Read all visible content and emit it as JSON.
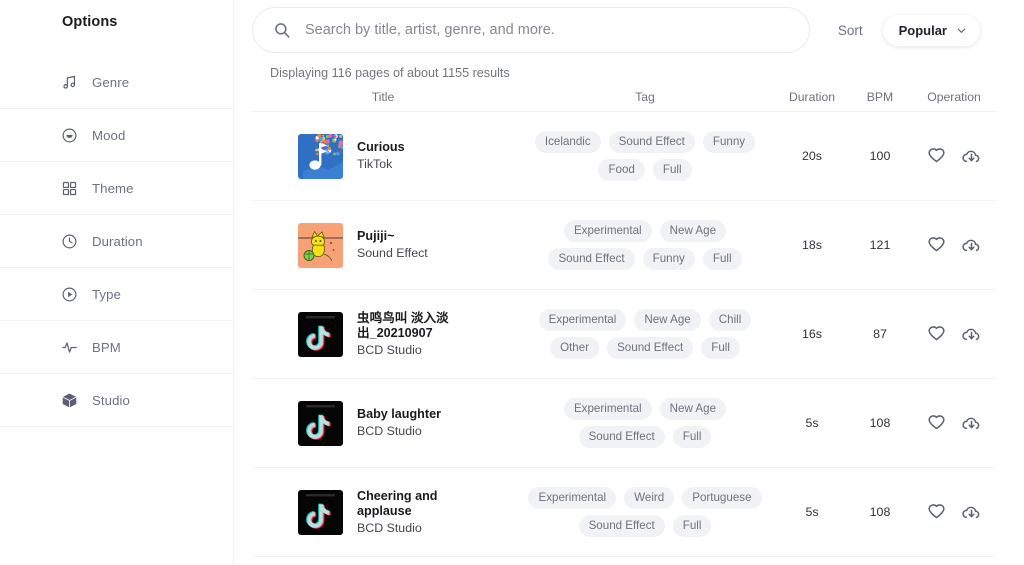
{
  "sidebar": {
    "title": "Options",
    "items": [
      {
        "label": "Genre",
        "icon": "music-note-icon"
      },
      {
        "label": "Mood",
        "icon": "mood-circle-icon"
      },
      {
        "label": "Theme",
        "icon": "grid-icon"
      },
      {
        "label": "Duration",
        "icon": "clock-icon"
      },
      {
        "label": "Type",
        "icon": "play-circle-icon"
      },
      {
        "label": "BPM",
        "icon": "waveform-icon"
      },
      {
        "label": "Studio",
        "icon": "cube-icon"
      }
    ]
  },
  "search": {
    "placeholder": "Search by title, artist, genre, and more.",
    "value": "",
    "icon": "search-icon"
  },
  "sort": {
    "label": "Sort",
    "selected": "Popular",
    "chevron": "chevron-down-icon"
  },
  "results_summary": "Displaying 116 pages of about 1155 results",
  "table": {
    "headers": {
      "title": "Title",
      "tag": "Tag",
      "duration": "Duration",
      "bpm": "BPM",
      "operation": "Operation"
    },
    "rows": [
      {
        "title": "Curious",
        "artist": "TikTok",
        "art": "confetti",
        "tags": [
          "Icelandic",
          "Sound Effect",
          "Funny",
          "Food",
          "Full"
        ],
        "duration": "20s",
        "bpm": "100",
        "operations": [
          "heart-icon",
          "cloud-download-icon"
        ]
      },
      {
        "title": "Pujiji~",
        "artist": "Sound Effect",
        "art": "cat",
        "tags": [
          "Experimental",
          "New Age",
          "Sound Effect",
          "Funny",
          "Full"
        ],
        "duration": "18s",
        "bpm": "121",
        "operations": [
          "heart-icon",
          "cloud-download-icon"
        ]
      },
      {
        "title": "虫鸣鸟叫 淡入淡出_20210907",
        "artist": "BCD Studio",
        "art": "tiktok",
        "tags": [
          "Experimental",
          "New Age",
          "Chill",
          "Other",
          "Sound Effect",
          "Full"
        ],
        "duration": "16s",
        "bpm": "87",
        "operations": [
          "heart-icon",
          "cloud-download-icon"
        ]
      },
      {
        "title": "Baby laughter",
        "artist": "BCD Studio",
        "art": "tiktok",
        "tags": [
          "Experimental",
          "New Age",
          "Sound Effect",
          "Full"
        ],
        "duration": "5s",
        "bpm": "108",
        "operations": [
          "heart-icon",
          "cloud-download-icon"
        ]
      },
      {
        "title": "Cheering and applause",
        "artist": "BCD Studio",
        "art": "tiktok",
        "tags": [
          "Experimental",
          "Weird",
          "Portuguese",
          "Sound Effect",
          "Full"
        ],
        "duration": "5s",
        "bpm": "108",
        "operations": [
          "heart-icon",
          "cloud-download-icon"
        ]
      }
    ]
  },
  "colors": {
    "pill_bg": "#f1f2f6",
    "pill_text": "#6e727c",
    "text_primary": "#1b1b1f",
    "text_muted": "#6b7280",
    "divider": "#f2f3f5"
  }
}
